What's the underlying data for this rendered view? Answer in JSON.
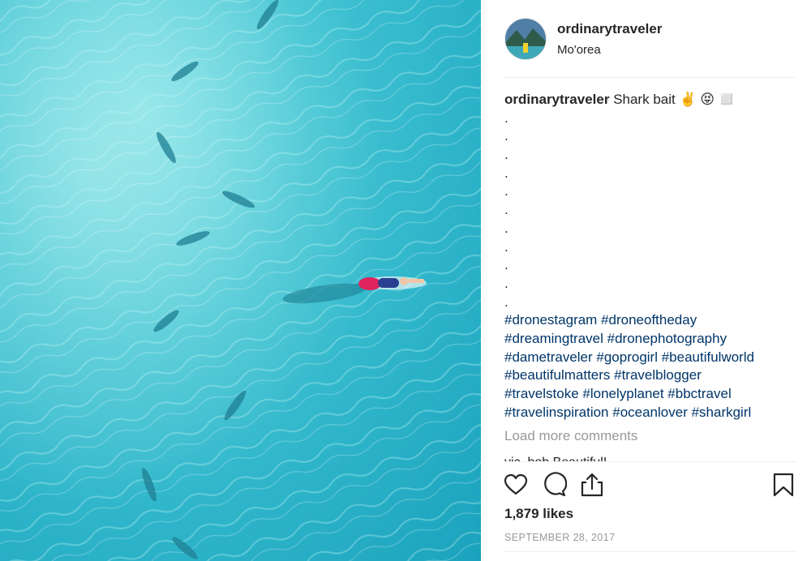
{
  "post": {
    "username": "ordinarytraveler",
    "location": "Mo'orea",
    "caption_text": "Shark bait ✌️ 😝 ◻️",
    "caption_dots": [
      ".",
      ".",
      ".",
      ".",
      ".",
      ".",
      ".",
      ".",
      ".",
      ".",
      "."
    ],
    "hashtag_lines": [
      "#dronestagram #droneoftheday",
      "#dreamingtravel #dronephotography",
      "#dametraveler #goprogirl #beautifulworld",
      "#beautifulmatters #travelblogger",
      "#travelstoke #lonelyplanet #bbctravel",
      "#travelinspiration #oceanlover #sharkgirl"
    ],
    "load_more_label": "Load more comments",
    "next_comment_partial": "vic_bob Beautiful!",
    "likes": "1,879 likes",
    "date": "SEPTEMBER 28, 2017"
  },
  "icons": {
    "like": "heart-outline-icon",
    "comment": "comment-bubble-icon",
    "share": "share-upload-icon",
    "save": "bookmark-icon"
  },
  "colors": {
    "water": "#2bb2c8",
    "hashtag": "#003569",
    "muted": "#999999",
    "text": "#262626",
    "board": "#e0245e"
  }
}
